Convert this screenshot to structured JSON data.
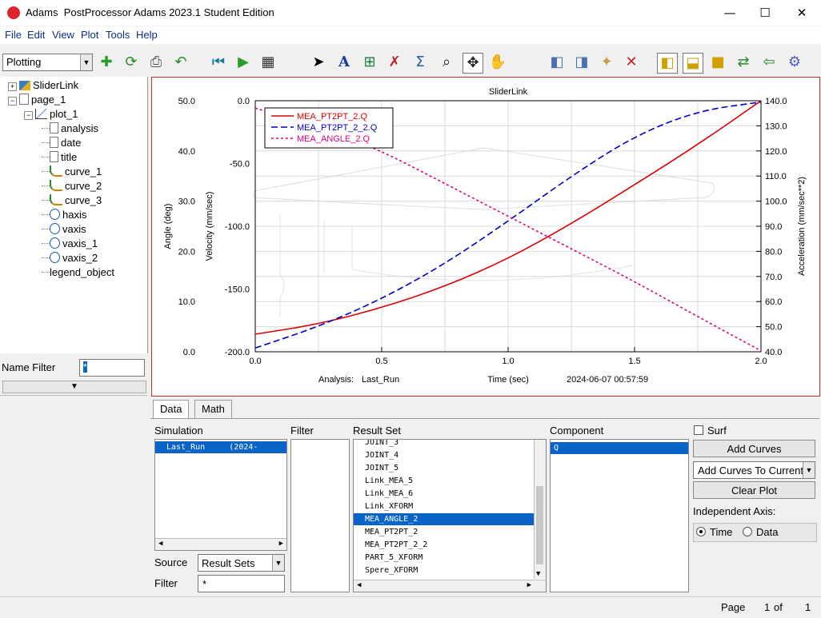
{
  "window": {
    "app_name": "Adams",
    "title": "PostProcessor Adams 2023.1 Student Edition",
    "minimize": "—",
    "maximize": "☐",
    "close": "✕"
  },
  "menu": [
    "File",
    "Edit",
    "View",
    "Plot",
    "Tools",
    "Help"
  ],
  "toolbar": {
    "mode": "Plotting",
    "icons": [
      "new-page-icon",
      "reload-icon",
      "print-icon",
      "undo-icon",
      "rewind-icon",
      "play-icon",
      "animation-icon",
      "select-arrow-icon",
      "text-tool-icon",
      "grid-tool-icon",
      "curve-edit-icon",
      "sigma-icon",
      "zoom-box-icon",
      "fit-icon",
      "pan-hand-icon",
      "prev-page-icon",
      "next-page-icon",
      "new-page-doc-icon",
      "delete-page-icon",
      "layout-1-icon",
      "layout-2-icon",
      "layout-3-icon",
      "swap-icon",
      "import-icon",
      "settings-gear-icon"
    ]
  },
  "tree": {
    "items": [
      {
        "label": "SliderLink",
        "icon": "model-icon",
        "level": 0,
        "expander": "+"
      },
      {
        "label": "page_1",
        "icon": "page-icon",
        "level": 0,
        "expander": "−"
      },
      {
        "label": "plot_1",
        "icon": "plot-icon",
        "level": 1,
        "expander": "−"
      },
      {
        "label": "analysis",
        "icon": "doc-icon",
        "level": 2
      },
      {
        "label": "date",
        "icon": "doc-icon",
        "level": 2
      },
      {
        "label": "title",
        "icon": "doc-icon",
        "level": 2
      },
      {
        "label": "curve_1",
        "icon": "curve-icon",
        "level": 2
      },
      {
        "label": "curve_2",
        "icon": "curve-icon",
        "level": 2
      },
      {
        "label": "curve_3",
        "icon": "curve-icon",
        "level": 2
      },
      {
        "label": "haxis",
        "icon": "axis-icon",
        "level": 2
      },
      {
        "label": "vaxis",
        "icon": "axis-icon",
        "level": 2
      },
      {
        "label": "vaxis_1",
        "icon": "axis-icon",
        "level": 2
      },
      {
        "label": "vaxis_2",
        "icon": "axis-icon",
        "level": 2
      },
      {
        "label": "legend_object",
        "icon": "none",
        "level": 2
      }
    ]
  },
  "name_filter": {
    "label": "Name Filter",
    "value": "*"
  },
  "chart_data": {
    "type": "line",
    "title": "SliderLink",
    "xlabel": "Time (sec)",
    "xlim": [
      0.0,
      2.0
    ],
    "x_ticks": [
      "0.0",
      "0.5",
      "1.0",
      "1.5",
      "2.0"
    ],
    "axes": {
      "angle": {
        "label": "Angle (deg)",
        "lim": [
          0,
          50
        ],
        "ticks": [
          "0.0",
          "10.0",
          "20.0",
          "30.0",
          "40.0",
          "50.0"
        ]
      },
      "velocity": {
        "label": "Velocity (mm/sec)",
        "lim": [
          -200,
          0
        ],
        "ticks": [
          "-200.0",
          "-150.0",
          "-100.0",
          "-50.0",
          "0.0"
        ]
      },
      "acceleration": {
        "label": "Acceleration (mm/sec**2)",
        "lim": [
          40,
          140
        ],
        "ticks": [
          "40.0",
          "50.0",
          "60.0",
          "70.0",
          "80.0",
          "90.0",
          "100.0",
          "110.0",
          "120.0",
          "130.0",
          "140.0"
        ]
      }
    },
    "series": [
      {
        "name": "MEA_PT2PT_2.Q",
        "color": "#dd0000",
        "dash": "solid",
        "axis": "velocity",
        "x": [
          0,
          0.25,
          0.5,
          0.75,
          1.0,
          1.25,
          1.5,
          1.75,
          2.0
        ],
        "y": [
          -186,
          -178,
          -165,
          -148,
          -126,
          -98,
          -67,
          -35,
          0
        ]
      },
      {
        "name": "MEA_PT2PT_2_2.Q",
        "color": "#0000cc",
        "dash": "dashed",
        "axis": "acceleration",
        "x": [
          0,
          0.25,
          0.5,
          0.75,
          1.0,
          1.25,
          1.5,
          1.75,
          2.0
        ],
        "y": [
          41.5,
          50,
          61,
          75,
          92,
          110,
          126,
          136,
          139.5
        ]
      },
      {
        "name": "MEA_ANGLE_2.Q",
        "color": "#dd0080",
        "dash": "dotted",
        "axis": "angle",
        "x": [
          0,
          0.25,
          0.5,
          0.75,
          1.0,
          1.25,
          1.5,
          1.75,
          2.0
        ],
        "y": [
          48.5,
          45,
          40,
          33.5,
          27,
          20.5,
          14,
          7,
          0.2
        ]
      }
    ],
    "legend_position": "top-left",
    "grid": true,
    "footer": {
      "analysis_label": "Analysis:",
      "analysis_value": "Last_Run",
      "date": "2024-06-07 00:57:59"
    }
  },
  "bottom": {
    "tabs": [
      "Data",
      "Math"
    ],
    "simulation": {
      "label": "Simulation",
      "items": [
        {
          "name": "Last_Run",
          "extra": "(2024-"
        }
      ]
    },
    "source": {
      "label": "Source",
      "value": "Result Sets"
    },
    "filter_bottom": {
      "label": "Filter",
      "value": "*"
    },
    "filter_label": "Filter",
    "result_set": {
      "label": "Result Set",
      "items": [
        "JOINT_3",
        "JOINT_4",
        "JOINT_5",
        "Link_MEA_5",
        "Link_MEA_6",
        "Link_XFORM",
        "MEA_ANGLE_2",
        "MEA_PT2PT_2",
        "MEA_PT2PT_2_2",
        "PART_5_XFORM",
        "Spere_XFORM"
      ],
      "selected": "MEA_ANGLE_2"
    },
    "component": {
      "label": "Component",
      "items": [
        "Q"
      ]
    },
    "surf": "Surf",
    "add_curves": "Add Curves",
    "add_curves_to": "Add Curves To Current",
    "clear_plot": "Clear Plot",
    "independent_axis": {
      "label": "Independent Axis:",
      "time": "Time",
      "data": "Data",
      "selected": "Time"
    }
  },
  "status": {
    "page_label": "Page",
    "page_num": "1",
    "of_label": "of",
    "page_total": "1"
  }
}
